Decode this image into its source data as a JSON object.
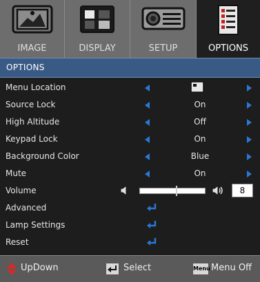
{
  "tabs": [
    {
      "label": "IMAGE",
      "icon": "image-icon"
    },
    {
      "label": "DISPLAY",
      "icon": "display-icon"
    },
    {
      "label": "SETUP",
      "icon": "setup-icon"
    },
    {
      "label": "OPTIONS",
      "icon": "options-icon",
      "active": true
    }
  ],
  "title": "OPTIONS",
  "menu": {
    "menu_location": {
      "label": "Menu Location",
      "value_icon": "menu-location-icon"
    },
    "source_lock": {
      "label": "Source Lock",
      "value": "On"
    },
    "high_altitude": {
      "label": "High Altitude",
      "value": "Off"
    },
    "keypad_lock": {
      "label": "Keypad Lock",
      "value": "On"
    },
    "background_color": {
      "label": "Background Color",
      "value": "Blue"
    },
    "mute": {
      "label": "Mute",
      "value": "On"
    },
    "volume": {
      "label": "Volume",
      "value": "8",
      "level_fraction": 0.57
    },
    "advanced": {
      "label": "Advanced"
    },
    "lamp_settings": {
      "label": "Lamp Settings"
    },
    "reset": {
      "label": "Reset"
    }
  },
  "footer": {
    "updown": "UpDown",
    "select": "Select",
    "menu_off": "Menu Off",
    "menu_key": "Menu"
  },
  "colors": {
    "accent_arrow": "#2a78d6",
    "title_bar": "#3a5a86",
    "tabs_bg": "#6d6d6d"
  }
}
